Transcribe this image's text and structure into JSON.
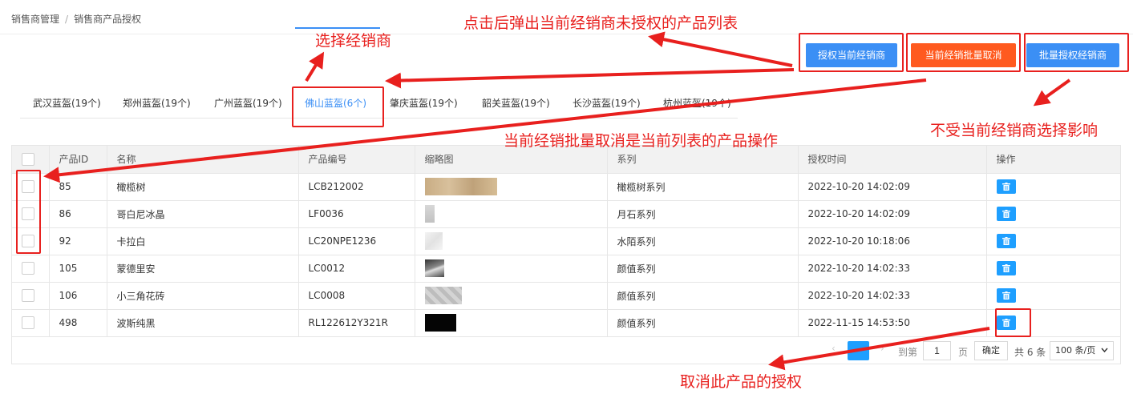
{
  "breadcrumb": {
    "level1": "销售商管理",
    "separator": "/",
    "level2": "销售商产品授权"
  },
  "toolbar": {
    "auth_current_label": "授权当前经销商",
    "cancel_batch_label": "当前经销批量取消",
    "batch_auth_label": "批量授权经销商"
  },
  "tabs": [
    {
      "label": "武汉蓝盔(19个)",
      "active": false
    },
    {
      "label": "郑州蓝盔(19个)",
      "active": false
    },
    {
      "label": "广州蓝盔(19个)",
      "active": false
    },
    {
      "label": "佛山蓝盔(6个)",
      "active": true
    },
    {
      "label": "肇庆蓝盔(19个)",
      "active": false
    },
    {
      "label": "韶关蓝盔(19个)",
      "active": false
    },
    {
      "label": "长沙蓝盔(19个)",
      "active": false
    },
    {
      "label": "杭州蓝盔(19个)",
      "active": false
    }
  ],
  "table": {
    "columns": [
      "产品ID",
      "名称",
      "产品编号",
      "缩略图",
      "系列",
      "授权时间",
      "操作"
    ],
    "rows": [
      {
        "id": "85",
        "name": "橄榄树",
        "code": "LCB212002",
        "thumb": "beige-wood",
        "series": "橄榄树系列",
        "time": "2022-10-20 14:02:09"
      },
      {
        "id": "86",
        "name": "哥白尼冰晶",
        "code": "LF0036",
        "thumb": "light-grey",
        "series": "月石系列",
        "time": "2022-10-20 14:02:09"
      },
      {
        "id": "92",
        "name": "卡拉白",
        "code": "LC20NPE1236",
        "thumb": "white-marble",
        "series": "水陌系列",
        "time": "2022-10-20 10:18:06"
      },
      {
        "id": "105",
        "name": "蒙德里安",
        "code": "LC0012",
        "thumb": "dark-grey",
        "series": "颜值系列",
        "time": "2022-10-20 14:02:33"
      },
      {
        "id": "106",
        "name": "小三角花砖",
        "code": "LC0008",
        "thumb": "grey-pattern",
        "series": "颜值系列",
        "time": "2022-10-20 14:02:33"
      },
      {
        "id": "498",
        "name": "波斯纯黑",
        "code": "RL122612Y321R",
        "thumb": "black",
        "series": "颜值系列",
        "time": "2022-11-15 14:53:50"
      }
    ]
  },
  "pagination": {
    "current_page": "1",
    "goto_label": "到第",
    "goto_value": "1",
    "page_label": "页",
    "confirm_label": "确定",
    "total_label": "共 6 条",
    "page_size": "100 条/页"
  },
  "annotations": {
    "popup_note": "点击后弹出当前经销商未授权的产品列表",
    "select_dealer_note": "选择经销商",
    "batch_cancel_note": "当前经销批量取消是当前列表的产品操作",
    "not_affected_note": "不受当前经销商选择影响",
    "cancel_product_note": "取消此产品的授权"
  },
  "colors": {
    "primary": "#3b8ff5",
    "danger": "#ff5a1f",
    "annotation": "#e8201e",
    "action": "#1e9fff"
  }
}
